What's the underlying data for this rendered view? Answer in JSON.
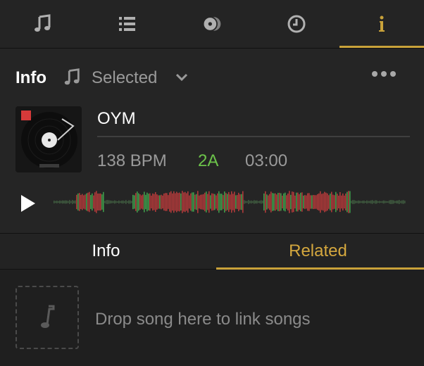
{
  "top_tabs": [
    {
      "icon": "music-note-icon",
      "active": false
    },
    {
      "icon": "list-icon",
      "active": false
    },
    {
      "icon": "disc-icon",
      "active": false
    },
    {
      "icon": "clock-icon",
      "active": false
    },
    {
      "icon": "info-icon",
      "active": true
    }
  ],
  "header": {
    "title": "Info",
    "selector_label": "Selected",
    "selector_icon": "music-note-icon",
    "more_icon": "more-dots-icon"
  },
  "track": {
    "title": "OYM",
    "bpm": "138 BPM",
    "key": "2A",
    "duration": "03:00",
    "artwork_icon": "vinyl-record-artwork"
  },
  "sub_tabs": {
    "info_label": "Info",
    "related_label": "Related",
    "active": "Related"
  },
  "related": {
    "drop_text": "Drop song here to link songs",
    "drop_icon": "music-note-icon"
  },
  "colors": {
    "accent": "#c9a23a",
    "key_color": "#6cc34a",
    "waveform_red": "#b03a3a",
    "waveform_green": "#3f9a4a"
  }
}
